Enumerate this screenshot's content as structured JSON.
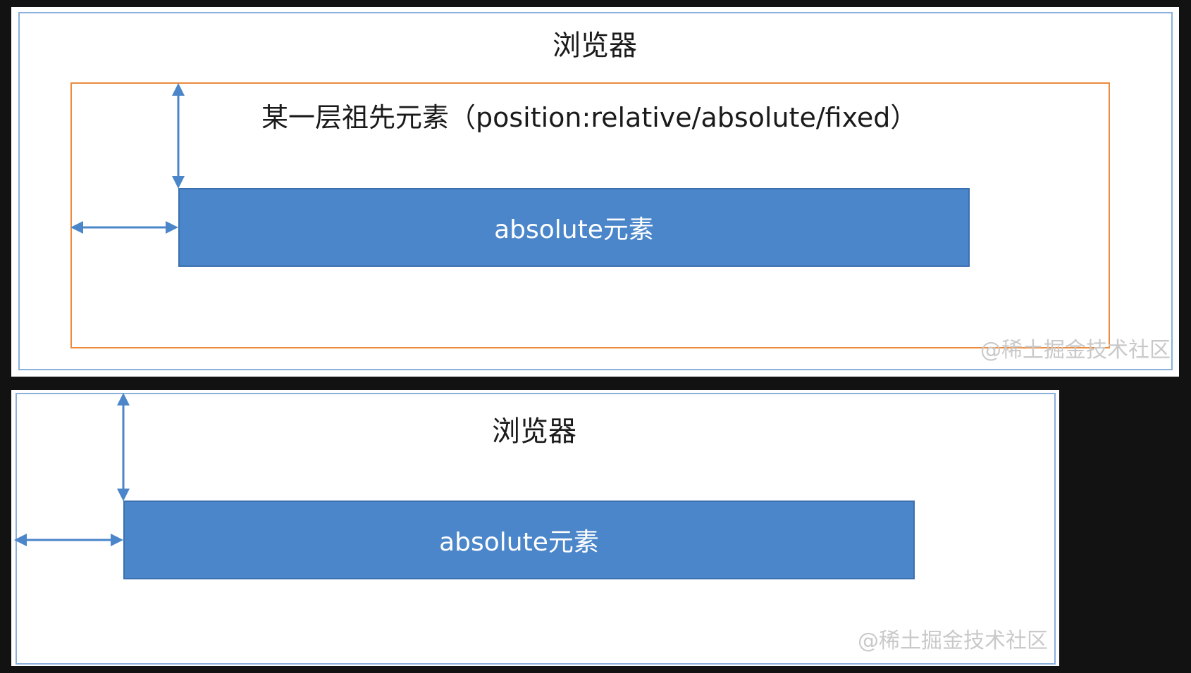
{
  "diagram_top": {
    "viewport_label": "浏览器",
    "ancestor_label": "某一层祖先元素（position:relative/absolute/fixed）",
    "absolute_label": "absolute元素",
    "watermark": "@稀土掘金技术社区"
  },
  "diagram_bottom": {
    "viewport_label": "浏览器",
    "absolute_label": "absolute元素",
    "watermark": "@稀土掘金技术社区"
  },
  "colors": {
    "background": "#121212",
    "viewport_border": "#8ab0dc",
    "ancestor_border": "#ec8a3d",
    "absolute_fill": "#4a86c9",
    "arrow": "#4a86c9"
  },
  "icons": {
    "vertical_offset_arrow": "double-headed-vertical-arrow",
    "horizontal_offset_arrow": "double-headed-horizontal-arrow"
  }
}
